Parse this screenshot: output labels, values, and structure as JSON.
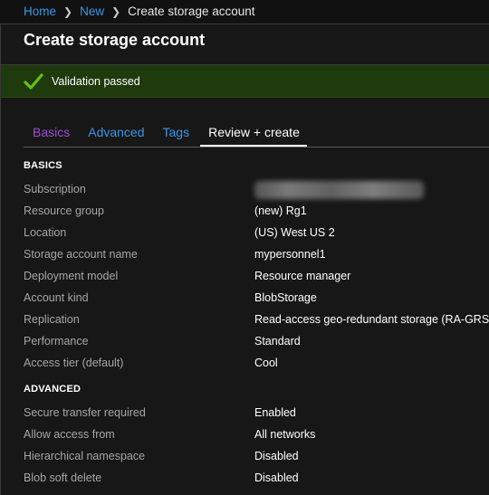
{
  "breadcrumb": {
    "home": "Home",
    "new": "New",
    "current": "Create storage account"
  },
  "page_title": "Create storage account",
  "validation": {
    "message": "Validation passed",
    "icon": "checkmark-icon",
    "color": "#64c40a"
  },
  "tabs": [
    {
      "label": "Basics"
    },
    {
      "label": "Advanced"
    },
    {
      "label": "Tags"
    },
    {
      "label": "Review + create",
      "selected": true
    }
  ],
  "basics": {
    "title": "BASICS",
    "rows": [
      {
        "label": "Subscription",
        "value": ""
      },
      {
        "label": "Resource group",
        "value": "(new) Rg1"
      },
      {
        "label": "Location",
        "value": "(US) West US 2"
      },
      {
        "label": "Storage account name",
        "value": "mypersonnel1"
      },
      {
        "label": "Deployment model",
        "value": "Resource manager"
      },
      {
        "label": "Account kind",
        "value": "BlobStorage"
      },
      {
        "label": "Replication",
        "value": "Read-access geo-redundant storage (RA-GRS)"
      },
      {
        "label": "Performance",
        "value": "Standard"
      },
      {
        "label": "Access tier (default)",
        "value": "Cool"
      }
    ]
  },
  "advanced": {
    "title": "ADVANCED",
    "rows": [
      {
        "label": "Secure transfer required",
        "value": "Enabled"
      },
      {
        "label": "Allow access from",
        "value": "All networks"
      },
      {
        "label": "Hierarchical namespace",
        "value": "Disabled"
      },
      {
        "label": "Blob soft delete",
        "value": "Disabled"
      }
    ]
  }
}
